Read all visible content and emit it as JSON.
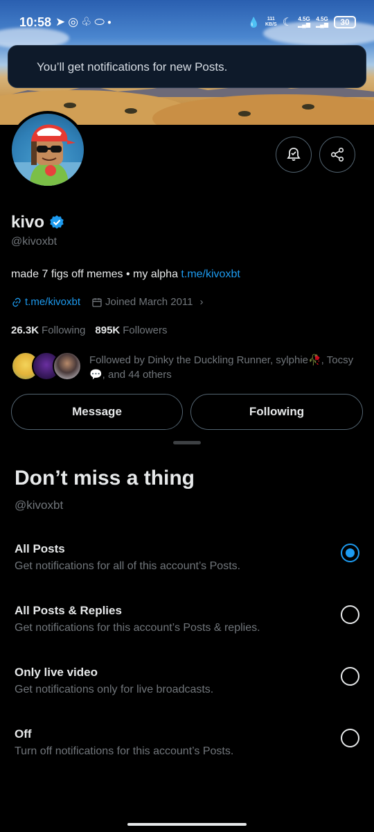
{
  "status_bar": {
    "time": "10:58",
    "speed_top": "111",
    "speed_unit": "KB/S",
    "net1": "4.5G",
    "net2": "4.5G",
    "battery": "30"
  },
  "toast": {
    "text": "You’ll get notifications for new Posts."
  },
  "profile": {
    "name": "kivo",
    "handle": "@kivoxbt",
    "bio_text": "made 7 figs off memes • my alpha ",
    "bio_link": "t.me/kivoxbt",
    "website": "t.me/kivoxbt",
    "joined": "Joined March 2011",
    "following_count": "26.3K",
    "following_label": "Following",
    "followers_count": "895K",
    "followers_label": "Followers",
    "followed_by": "Followed by Dinky the Duckling Runner, sylphie🥀, Tocsy💬, and 44 others",
    "message_button": "Message",
    "following_button": "Following",
    "accent_color": "#1d9bf0"
  },
  "sheet": {
    "title": "Don’t miss a thing",
    "handle": "@kivoxbt",
    "options": [
      {
        "title": "All Posts",
        "desc": "Get notifications for all of this account’s Posts.",
        "selected": true
      },
      {
        "title": "All Posts & Replies",
        "desc": "Get notifications for this account’s Posts & replies.",
        "selected": false
      },
      {
        "title": "Only live video",
        "desc": "Get notifications only for live broadcasts.",
        "selected": false
      },
      {
        "title": "Off",
        "desc": "Turn off notifications for this account’s Posts.",
        "selected": false
      }
    ]
  }
}
